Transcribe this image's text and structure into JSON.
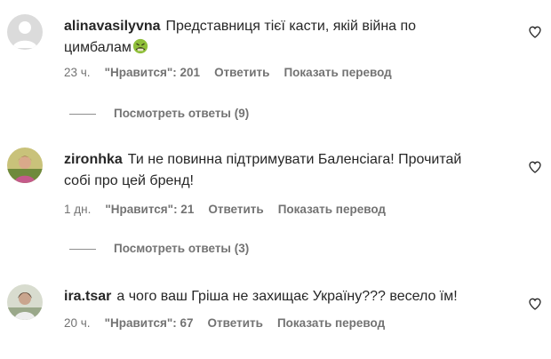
{
  "comments": [
    {
      "username": "alinavasilyvna",
      "text_line1": "Представниця тієї касти, якій війна по",
      "text_line2": "цимбалам",
      "emoji": "nauseated-face-emoji",
      "time": "23 ч.",
      "likes": "\"Нравится\": 201",
      "reply": "Ответить",
      "translate": "Показать перевод",
      "view_replies": "Посмотреть ответы (9)",
      "avatar": "default-avatar"
    },
    {
      "username": "zironhka",
      "text_line1": "Ти не повинна підтримувати Баленсіага! Прочитай",
      "text_line2": "собі про цей бренд!",
      "time": "1 дн.",
      "likes": "\"Нравится\": 21",
      "reply": "Ответить",
      "translate": "Показать перевод",
      "view_replies": "Посмотреть ответы (3)",
      "avatar": "photo-avatar"
    },
    {
      "username": "ira.tsar",
      "text_line1": "а чого ваш Гріша не захищає Україну??? весело їм!",
      "time": "20 ч.",
      "likes": "\"Нравится\": 67",
      "reply": "Ответить",
      "translate": "Показать перевод",
      "avatar": "photo-avatar"
    }
  ],
  "icons": {
    "like": "heart-outline-icon"
  },
  "colors": {
    "text": "#262626",
    "secondary": "#737373",
    "avatar_default": "#dbdbdb"
  }
}
